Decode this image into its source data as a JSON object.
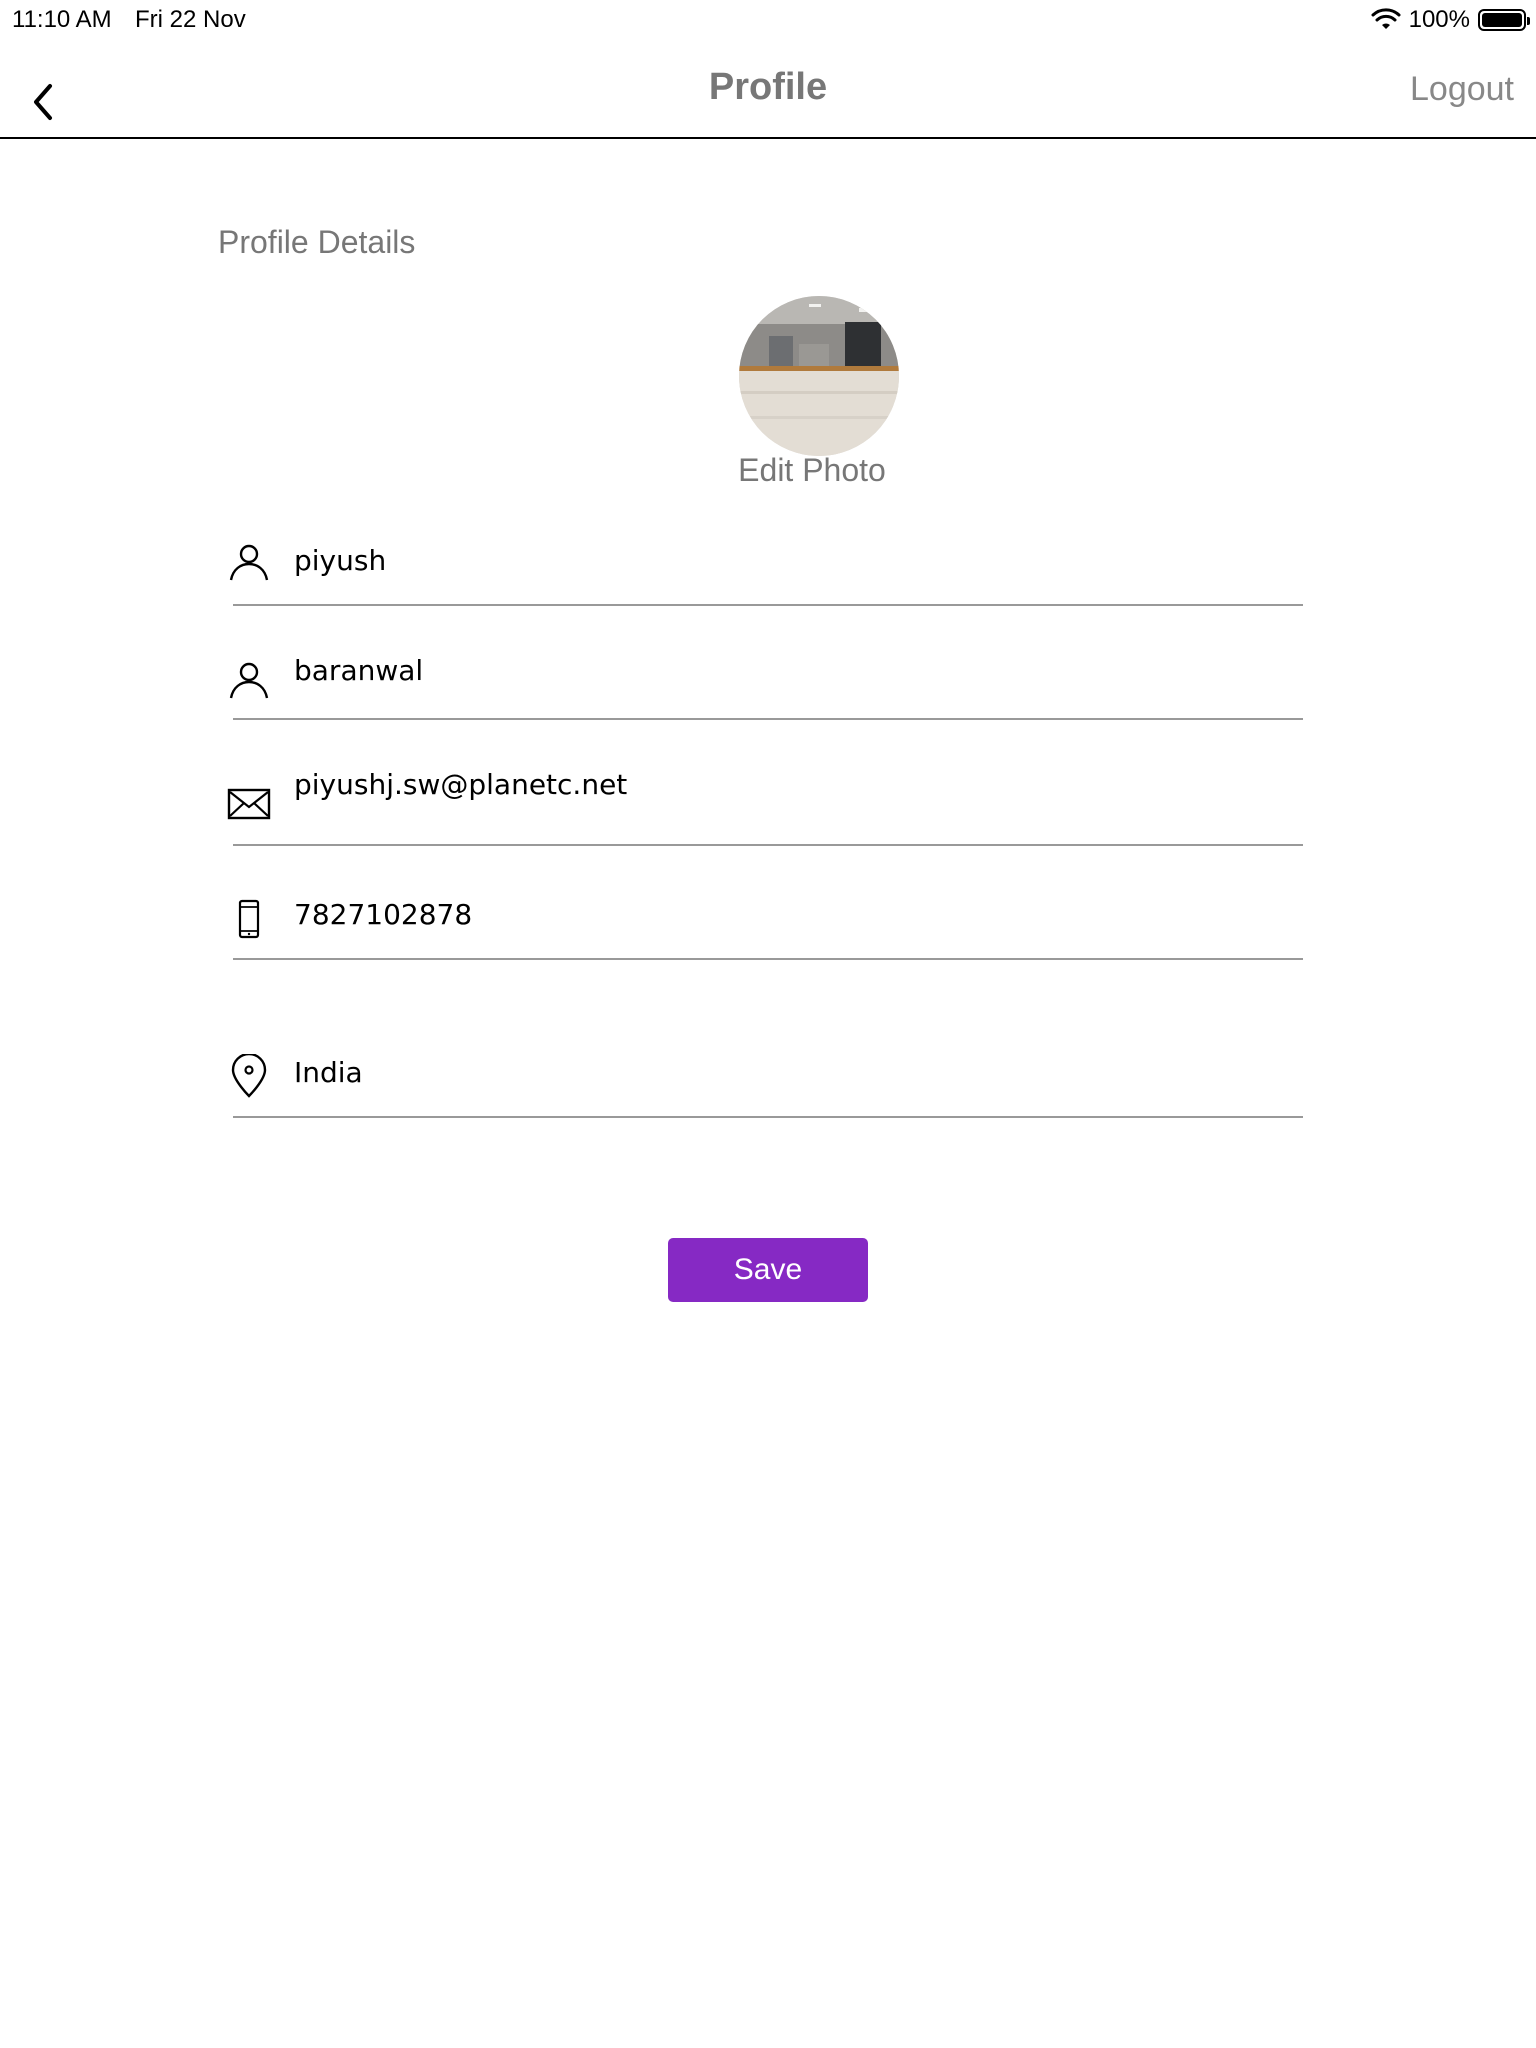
{
  "status_bar": {
    "time": "11:10 AM",
    "date": "Fri 22 Nov",
    "battery_text": "100%",
    "wifi_icon": "wifi-icon",
    "battery_icon": "battery-icon"
  },
  "nav": {
    "back_icon": "chevron-left-icon",
    "title": "Profile",
    "logout_label": "Logout"
  },
  "profile": {
    "section_title": "Profile Details",
    "edit_photo_label": "Edit Photo",
    "fields": {
      "first_name": {
        "value": "piyush",
        "icon": "user-icon"
      },
      "last_name": {
        "value": "baranwal",
        "icon": "user-icon"
      },
      "email": {
        "value": "piyushj.sw@planetc.net",
        "icon": "envelope-icon"
      },
      "phone": {
        "value": "7827102878",
        "icon": "mobile-phone-icon"
      },
      "country": {
        "value": "India",
        "icon": "location-pin-icon"
      }
    },
    "save_label": "Save"
  },
  "colors": {
    "accent": "#8629c4",
    "muted_text": "#777777",
    "divider": "#999999"
  }
}
